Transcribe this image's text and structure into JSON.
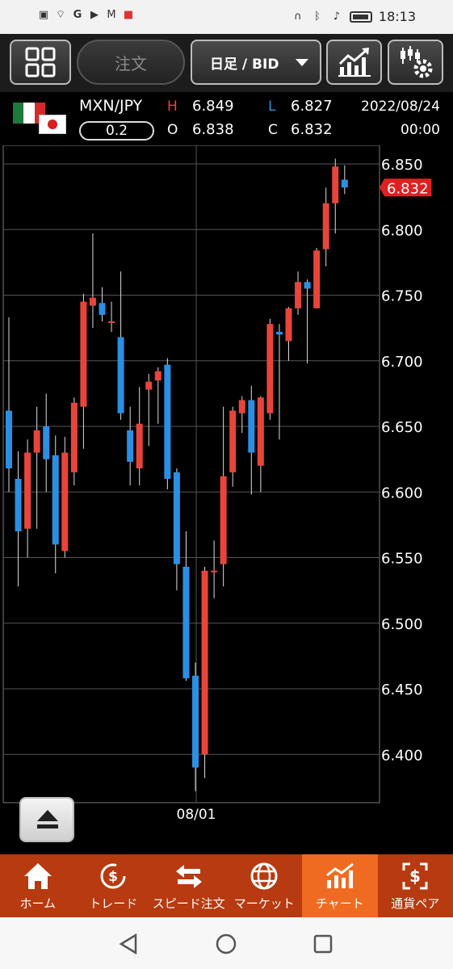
{
  "status_bar": {
    "time": "18:13",
    "left_icons": [
      "photo-icon",
      "wifi-icon",
      "g-icon",
      "youtube-icon",
      "gmail-icon",
      "shop-icon"
    ],
    "right_icons": [
      "headset-icon",
      "bluetooth-icon",
      "mute-icon",
      "battery-icon"
    ]
  },
  "toolbar": {
    "order_label": "注文",
    "period_label": "日足 / BID"
  },
  "quote": {
    "pair": "MXN/JPY",
    "spread": "0.2",
    "high_label": "H",
    "high": "6.849",
    "low_label": "L",
    "low": "6.827",
    "open_label": "O",
    "open": "6.838",
    "close_label": "C",
    "close": "6.832",
    "date": "2022/08/24",
    "time": "00:00"
  },
  "colors": {
    "up": "#e8453a",
    "down": "#2b8fe3",
    "grid": "#555555",
    "price_tag": "#e02020",
    "nav_bg": "#b73a10",
    "nav_active": "#f06b22"
  },
  "chart_data": {
    "type": "candlestick",
    "symbol": "MXN/JPY",
    "timeframe": "日足 / BID",
    "ylim": [
      6.37,
      6.86
    ],
    "yticks": [
      "6.850",
      "6.800",
      "6.750",
      "6.700",
      "6.650",
      "6.600",
      "6.550",
      "6.500",
      "6.450",
      "6.400"
    ],
    "x_marker_label": "08/01",
    "x_marker_index": 20,
    "current_price": "6.832",
    "candles": [
      {
        "o": 6.662,
        "h": 6.733,
        "l": 6.6,
        "c": 6.618
      },
      {
        "o": 6.61,
        "h": 6.631,
        "l": 6.528,
        "c": 6.57
      },
      {
        "o": 6.572,
        "h": 6.64,
        "l": 6.55,
        "c": 6.63
      },
      {
        "o": 6.63,
        "h": 6.665,
        "l": 6.572,
        "c": 6.647
      },
      {
        "o": 6.65,
        "h": 6.675,
        "l": 6.6,
        "c": 6.625
      },
      {
        "o": 6.628,
        "h": 6.643,
        "l": 6.538,
        "c": 6.56
      },
      {
        "o": 6.555,
        "h": 6.642,
        "l": 6.55,
        "c": 6.63
      },
      {
        "o": 6.615,
        "h": 6.672,
        "l": 6.605,
        "c": 6.668
      },
      {
        "o": 6.665,
        "h": 6.751,
        "l": 6.633,
        "c": 6.745
      },
      {
        "o": 6.742,
        "h": 6.797,
        "l": 6.725,
        "c": 6.748
      },
      {
        "o": 6.744,
        "h": 6.756,
        "l": 6.73,
        "c": 6.735
      },
      {
        "o": 6.73,
        "h": 6.745,
        "l": 6.722,
        "c": 6.73
      },
      {
        "o": 6.718,
        "h": 6.768,
        "l": 6.655,
        "c": 6.66
      },
      {
        "o": 6.647,
        "h": 6.665,
        "l": 6.605,
        "c": 6.623
      },
      {
        "o": 6.618,
        "h": 6.68,
        "l": 6.605,
        "c": 6.652
      },
      {
        "o": 6.678,
        "h": 6.69,
        "l": 6.635,
        "c": 6.684
      },
      {
        "o": 6.685,
        "h": 6.695,
        "l": 6.652,
        "c": 6.692
      },
      {
        "o": 6.697,
        "h": 6.702,
        "l": 6.602,
        "c": 6.61
      },
      {
        "o": 6.615,
        "h": 6.618,
        "l": 6.525,
        "c": 6.545
      },
      {
        "o": 6.543,
        "h": 6.57,
        "l": 6.456,
        "c": 6.458
      },
      {
        "o": 6.46,
        "h": 6.47,
        "l": 6.372,
        "c": 6.39
      },
      {
        "o": 6.4,
        "h": 6.543,
        "l": 6.382,
        "c": 6.54
      },
      {
        "o": 6.54,
        "h": 6.563,
        "l": 6.519,
        "c": 6.54
      },
      {
        "o": 6.545,
        "h": 6.665,
        "l": 6.528,
        "c": 6.612
      },
      {
        "o": 6.615,
        "h": 6.665,
        "l": 6.604,
        "c": 6.662
      },
      {
        "o": 6.66,
        "h": 6.673,
        "l": 6.645,
        "c": 6.67
      },
      {
        "o": 6.67,
        "h": 6.681,
        "l": 6.598,
        "c": 6.63
      },
      {
        "o": 6.62,
        "h": 6.673,
        "l": 6.6,
        "c": 6.672
      },
      {
        "o": 6.66,
        "h": 6.732,
        "l": 6.655,
        "c": 6.728
      },
      {
        "o": 6.722,
        "h": 6.728,
        "l": 6.64,
        "c": 6.72
      },
      {
        "o": 6.715,
        "h": 6.741,
        "l": 6.7,
        "c": 6.74
      },
      {
        "o": 6.74,
        "h": 6.768,
        "l": 6.735,
        "c": 6.76
      },
      {
        "o": 6.76,
        "h": 6.762,
        "l": 6.698,
        "c": 6.755
      },
      {
        "o": 6.74,
        "h": 6.786,
        "l": 6.74,
        "c": 6.784
      },
      {
        "o": 6.785,
        "h": 6.832,
        "l": 6.772,
        "c": 6.82
      },
      {
        "o": 6.82,
        "h": 6.854,
        "l": 6.797,
        "c": 6.848
      },
      {
        "o": 6.838,
        "h": 6.849,
        "l": 6.827,
        "c": 6.832
      }
    ]
  },
  "bottom_nav": [
    {
      "label": "ホーム",
      "icon": "home-icon"
    },
    {
      "label": "トレード",
      "icon": "trade-icon"
    },
    {
      "label": "スピード注文",
      "icon": "speed-order-icon"
    },
    {
      "label": "マーケット",
      "icon": "market-icon"
    },
    {
      "label": "チャート",
      "icon": "chart-icon",
      "active": true
    },
    {
      "label": "通貨ペア",
      "icon": "currency-pair-icon"
    }
  ]
}
